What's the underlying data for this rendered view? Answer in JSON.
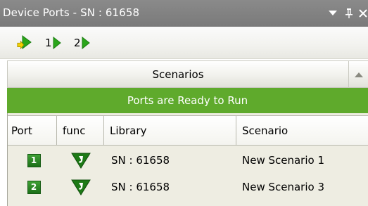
{
  "window": {
    "title": "Device Ports - SN : 61658",
    "buttons": [
      "dropdown",
      "pin",
      "close"
    ]
  },
  "toolbar": {
    "items": [
      {
        "icon": "run-all-ports-icon",
        "label": ""
      },
      {
        "icon": "run-port-icon",
        "label": "1"
      },
      {
        "icon": "run-port-icon",
        "label": "2"
      }
    ]
  },
  "section": {
    "title": "Scenarios"
  },
  "status": {
    "text": "Ports are Ready to Run",
    "color": "#5faa2c"
  },
  "table": {
    "columns": [
      "Port",
      "func",
      "Library",
      "Scenario"
    ],
    "rows": [
      {
        "port": "1",
        "func_icon": "v-logo-icon",
        "library": "SN : 61658",
        "scenario": "New Scenario 1"
      },
      {
        "port": "2",
        "func_icon": "v-logo-icon",
        "library": "SN : 61658",
        "scenario": "New Scenario 3"
      }
    ]
  }
}
